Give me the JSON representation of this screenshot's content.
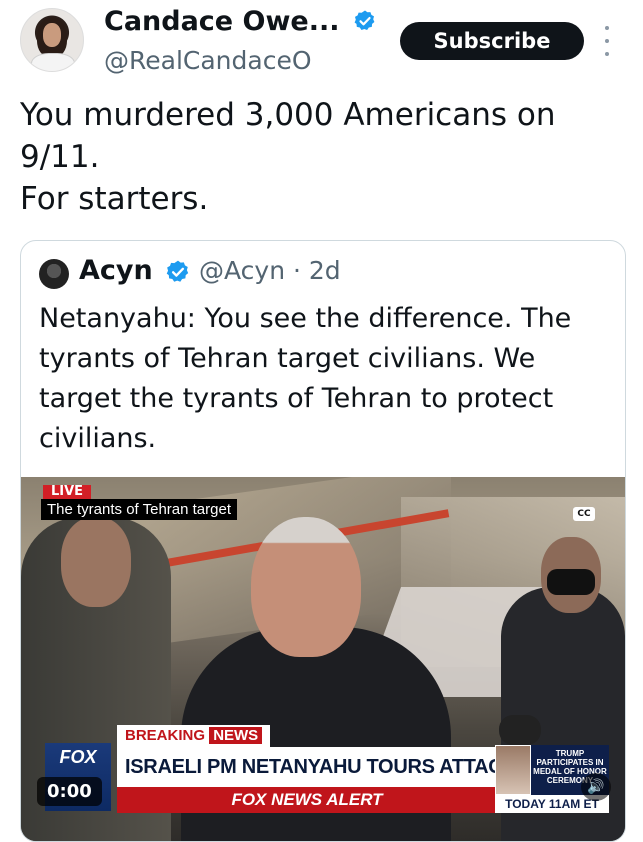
{
  "author": {
    "display_name": "Candace Owe...",
    "handle": "@RealCandaceO",
    "verified_icon": "verified-badge-icon",
    "subscribe_label": "Subscribe"
  },
  "tweet": {
    "lines": [
      "You murdered 3,000 Americans on",
      "9/11.",
      "For starters."
    ]
  },
  "quote": {
    "display_name": "Acyn",
    "handle_time": "@Acyn · 2d",
    "lines": [
      "Netanyahu: You see the difference. The",
      "tyrants of Tehran target civilians. We",
      "target the tyrants of Tehran to protect",
      "civilians."
    ],
    "video": {
      "live_label": "LIVE",
      "caption": "The tyrants of Tehran target",
      "cc_label": "CC",
      "breaking_a": "BREAKING",
      "breaking_b": "NEWS",
      "headline": "ISRAELI PM NETANYAHU TOURS ATTACK SITE",
      "alert_bar": "FOX NEWS ALERT",
      "logo": "FOX",
      "side_box": "TRUMP PARTICIPATES IN MEDAL OF HONOR CEREMONY",
      "today_label": "TODAY 11AM ET",
      "timestamp": "0:00",
      "volume_icon": "speaker-icon"
    }
  },
  "colors": {
    "brand_blue": "#1d9bf0",
    "text": "#0f1419",
    "muted": "#536471",
    "fox_red": "#c0151b"
  }
}
